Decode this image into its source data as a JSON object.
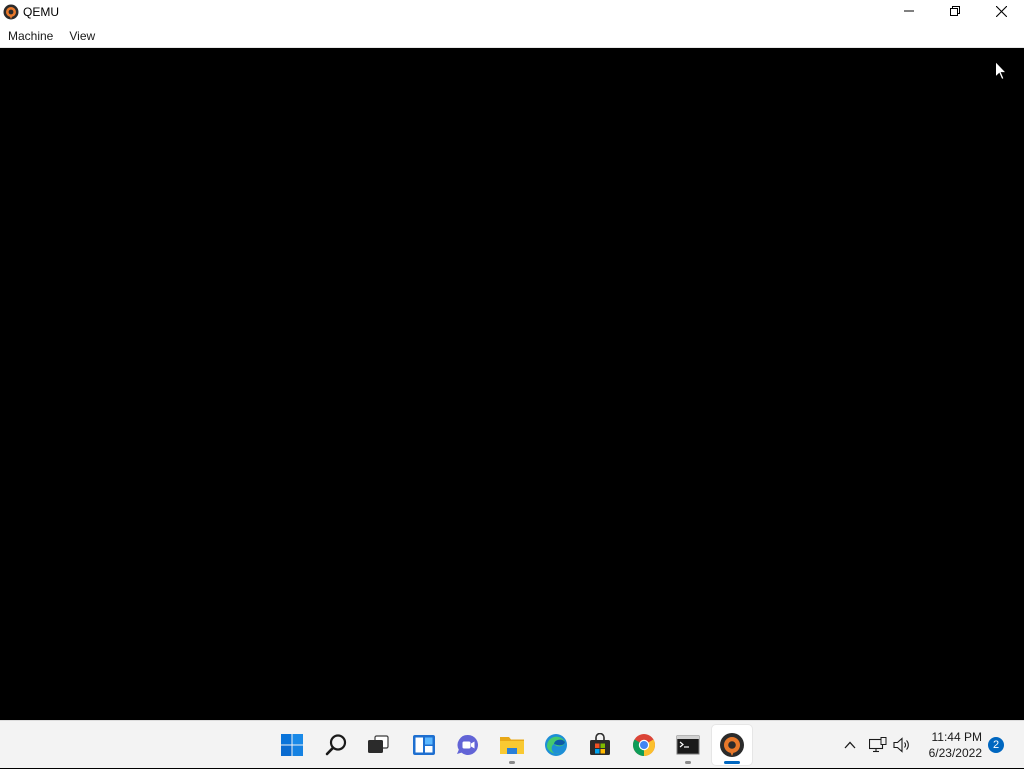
{
  "window": {
    "title": "QEMU",
    "icon": "qemu-icon",
    "controls": [
      "minimize-icon",
      "restore-icon",
      "close-icon"
    ]
  },
  "menubar": {
    "items": [
      {
        "label": "Machine"
      },
      {
        "label": "View"
      }
    ]
  },
  "taskbar": {
    "apps": [
      {
        "name": "start",
        "icon": "windows-start-icon",
        "running": false
      },
      {
        "name": "search",
        "icon": "search-icon",
        "running": false
      },
      {
        "name": "task-view",
        "icon": "task-view-icon",
        "running": false
      },
      {
        "name": "widgets",
        "icon": "widgets-icon",
        "running": false
      },
      {
        "name": "teams-chat",
        "icon": "teams-chat-icon",
        "running": false
      },
      {
        "name": "file-explorer",
        "icon": "file-explorer-icon",
        "running": true
      },
      {
        "name": "edge",
        "icon": "edge-icon",
        "running": false
      },
      {
        "name": "store",
        "icon": "store-icon",
        "running": false
      },
      {
        "name": "chrome",
        "icon": "chrome-icon",
        "running": false
      },
      {
        "name": "command-prompt",
        "icon": "command-prompt-icon",
        "running": true
      },
      {
        "name": "qemu",
        "icon": "qemu-icon",
        "running": true,
        "active": true
      }
    ],
    "tray": {
      "icons": [
        "chevron-up-icon",
        "network-icon",
        "volume-icon"
      ],
      "time": "11:44 PM",
      "date": "6/23/2022",
      "notifications": "2"
    }
  },
  "colors": {
    "accent": "#0067c0",
    "screen": "#000000",
    "taskbar": "#f3f3f3"
  }
}
